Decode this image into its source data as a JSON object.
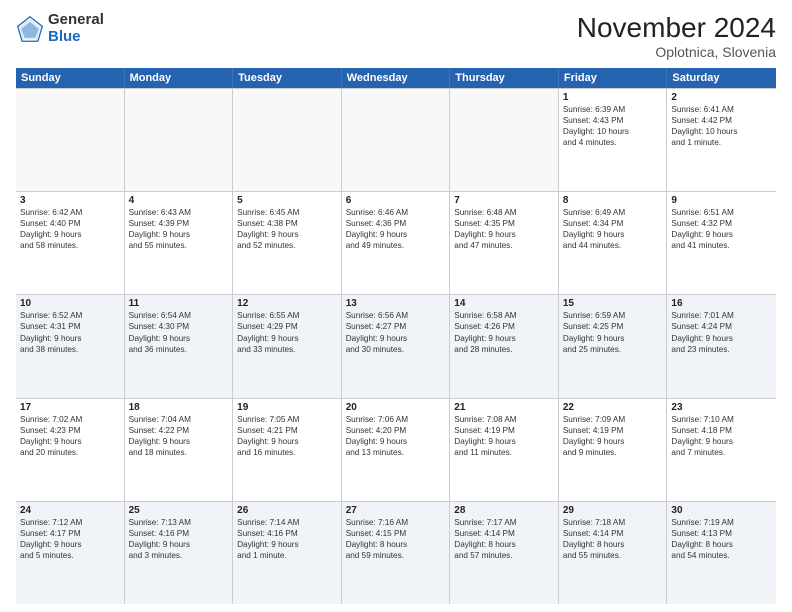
{
  "logo": {
    "general": "General",
    "blue": "Blue"
  },
  "title": "November 2024",
  "subtitle": "Oplotnica, Slovenia",
  "days_header": [
    "Sunday",
    "Monday",
    "Tuesday",
    "Wednesday",
    "Thursday",
    "Friday",
    "Saturday"
  ],
  "rows": [
    [
      {
        "day": "",
        "info": ""
      },
      {
        "day": "",
        "info": ""
      },
      {
        "day": "",
        "info": ""
      },
      {
        "day": "",
        "info": ""
      },
      {
        "day": "",
        "info": ""
      },
      {
        "day": "1",
        "info": "Sunrise: 6:39 AM\nSunset: 4:43 PM\nDaylight: 10 hours\nand 4 minutes."
      },
      {
        "day": "2",
        "info": "Sunrise: 6:41 AM\nSunset: 4:42 PM\nDaylight: 10 hours\nand 1 minute."
      }
    ],
    [
      {
        "day": "3",
        "info": "Sunrise: 6:42 AM\nSunset: 4:40 PM\nDaylight: 9 hours\nand 58 minutes."
      },
      {
        "day": "4",
        "info": "Sunrise: 6:43 AM\nSunset: 4:39 PM\nDaylight: 9 hours\nand 55 minutes."
      },
      {
        "day": "5",
        "info": "Sunrise: 6:45 AM\nSunset: 4:38 PM\nDaylight: 9 hours\nand 52 minutes."
      },
      {
        "day": "6",
        "info": "Sunrise: 6:46 AM\nSunset: 4:36 PM\nDaylight: 9 hours\nand 49 minutes."
      },
      {
        "day": "7",
        "info": "Sunrise: 6:48 AM\nSunset: 4:35 PM\nDaylight: 9 hours\nand 47 minutes."
      },
      {
        "day": "8",
        "info": "Sunrise: 6:49 AM\nSunset: 4:34 PM\nDaylight: 9 hours\nand 44 minutes."
      },
      {
        "day": "9",
        "info": "Sunrise: 6:51 AM\nSunset: 4:32 PM\nDaylight: 9 hours\nand 41 minutes."
      }
    ],
    [
      {
        "day": "10",
        "info": "Sunrise: 6:52 AM\nSunset: 4:31 PM\nDaylight: 9 hours\nand 38 minutes."
      },
      {
        "day": "11",
        "info": "Sunrise: 6:54 AM\nSunset: 4:30 PM\nDaylight: 9 hours\nand 36 minutes."
      },
      {
        "day": "12",
        "info": "Sunrise: 6:55 AM\nSunset: 4:29 PM\nDaylight: 9 hours\nand 33 minutes."
      },
      {
        "day": "13",
        "info": "Sunrise: 6:56 AM\nSunset: 4:27 PM\nDaylight: 9 hours\nand 30 minutes."
      },
      {
        "day": "14",
        "info": "Sunrise: 6:58 AM\nSunset: 4:26 PM\nDaylight: 9 hours\nand 28 minutes."
      },
      {
        "day": "15",
        "info": "Sunrise: 6:59 AM\nSunset: 4:25 PM\nDaylight: 9 hours\nand 25 minutes."
      },
      {
        "day": "16",
        "info": "Sunrise: 7:01 AM\nSunset: 4:24 PM\nDaylight: 9 hours\nand 23 minutes."
      }
    ],
    [
      {
        "day": "17",
        "info": "Sunrise: 7:02 AM\nSunset: 4:23 PM\nDaylight: 9 hours\nand 20 minutes."
      },
      {
        "day": "18",
        "info": "Sunrise: 7:04 AM\nSunset: 4:22 PM\nDaylight: 9 hours\nand 18 minutes."
      },
      {
        "day": "19",
        "info": "Sunrise: 7:05 AM\nSunset: 4:21 PM\nDaylight: 9 hours\nand 16 minutes."
      },
      {
        "day": "20",
        "info": "Sunrise: 7:06 AM\nSunset: 4:20 PM\nDaylight: 9 hours\nand 13 minutes."
      },
      {
        "day": "21",
        "info": "Sunrise: 7:08 AM\nSunset: 4:19 PM\nDaylight: 9 hours\nand 11 minutes."
      },
      {
        "day": "22",
        "info": "Sunrise: 7:09 AM\nSunset: 4:19 PM\nDaylight: 9 hours\nand 9 minutes."
      },
      {
        "day": "23",
        "info": "Sunrise: 7:10 AM\nSunset: 4:18 PM\nDaylight: 9 hours\nand 7 minutes."
      }
    ],
    [
      {
        "day": "24",
        "info": "Sunrise: 7:12 AM\nSunset: 4:17 PM\nDaylight: 9 hours\nand 5 minutes."
      },
      {
        "day": "25",
        "info": "Sunrise: 7:13 AM\nSunset: 4:16 PM\nDaylight: 9 hours\nand 3 minutes."
      },
      {
        "day": "26",
        "info": "Sunrise: 7:14 AM\nSunset: 4:16 PM\nDaylight: 9 hours\nand 1 minute."
      },
      {
        "day": "27",
        "info": "Sunrise: 7:16 AM\nSunset: 4:15 PM\nDaylight: 8 hours\nand 59 minutes."
      },
      {
        "day": "28",
        "info": "Sunrise: 7:17 AM\nSunset: 4:14 PM\nDaylight: 8 hours\nand 57 minutes."
      },
      {
        "day": "29",
        "info": "Sunrise: 7:18 AM\nSunset: 4:14 PM\nDaylight: 8 hours\nand 55 minutes."
      },
      {
        "day": "30",
        "info": "Sunrise: 7:19 AM\nSunset: 4:13 PM\nDaylight: 8 hours\nand 54 minutes."
      }
    ]
  ]
}
